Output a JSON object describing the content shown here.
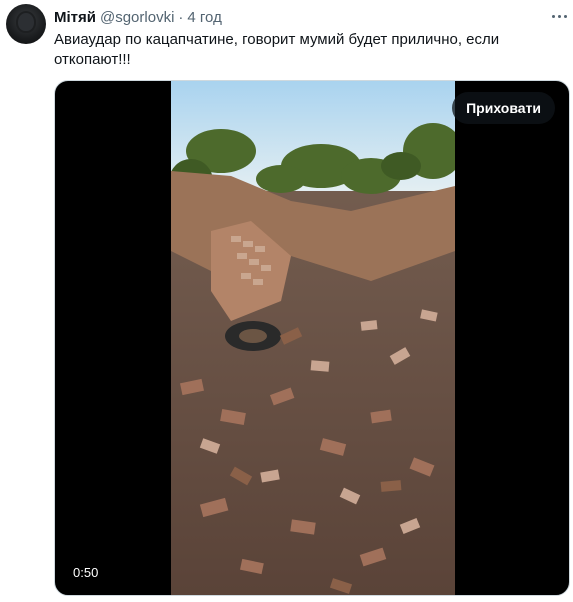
{
  "tweet": {
    "author_name": "Мітяй",
    "author_handle": "@sgorlovki",
    "separator": "·",
    "timestamp": "4 год",
    "text": "Авиаудар по кацапчатине, говорит мумий будет прилично, если откопают!!!"
  },
  "media": {
    "hide_label": "Приховати",
    "duration": "0:50"
  },
  "icons": {
    "more": "more-options-icon"
  }
}
